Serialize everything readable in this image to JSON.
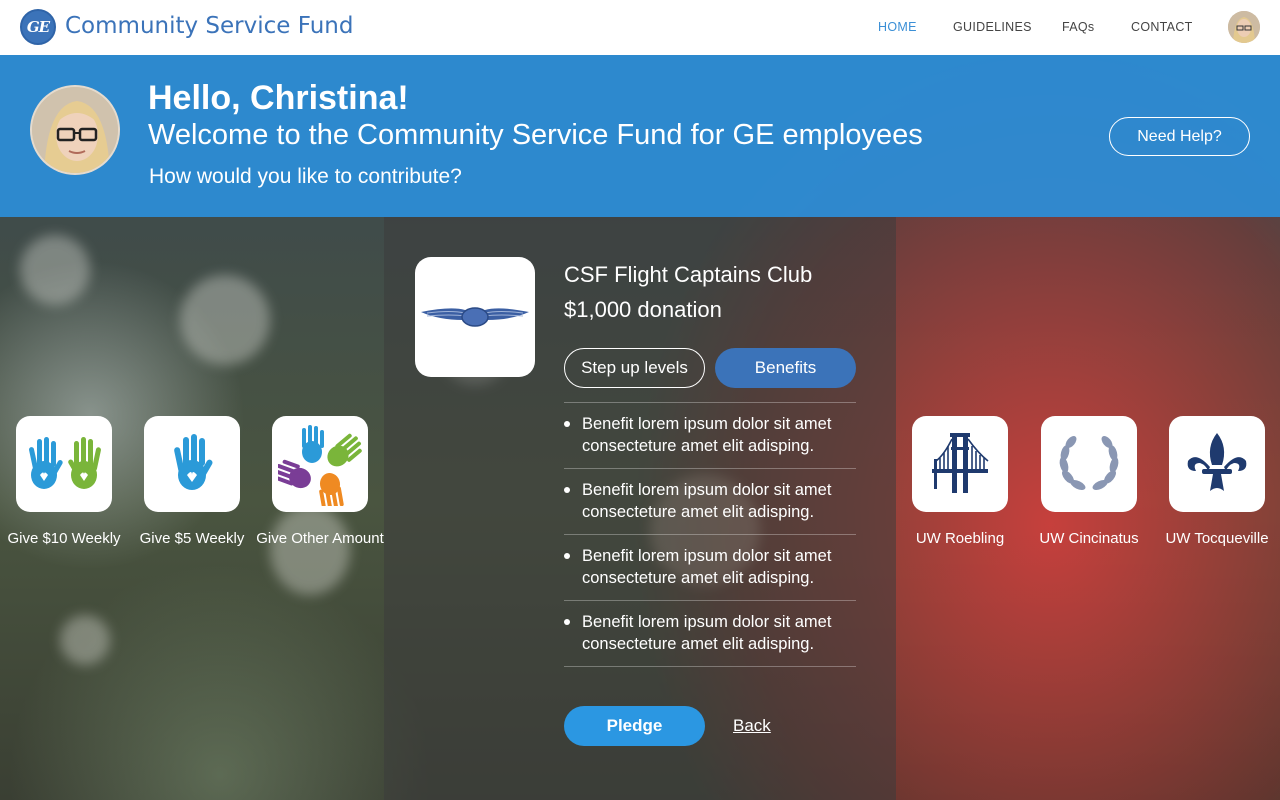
{
  "header": {
    "logo_text": "GE",
    "brand": "Community Service Fund",
    "nav": [
      "HOME",
      "GUIDELINES",
      "FAQs",
      "CONTACT"
    ],
    "active_nav": "HOME"
  },
  "banner": {
    "hello": "Hello, Christina!",
    "welcome": "Welcome to the Community Service Fund for GE employees",
    "question": "How would you like to contribute?",
    "help_button": "Need Help?"
  },
  "left_options": [
    {
      "label": "Give $10 Weekly",
      "icon": "two-hands-icon"
    },
    {
      "label": "Give $5 Weekly",
      "icon": "hand-icon"
    },
    {
      "label": "Give Other Amount",
      "icon": "many-hands-icon"
    }
  ],
  "club": {
    "title": "CSF Flight Captains Club",
    "amount": "$1,000 donation",
    "icon": "wings-icon",
    "tabs": [
      "Step up levels",
      "Benefits"
    ],
    "active_tab": "Benefits",
    "benefits": [
      "Benefit lorem ipsum dolor sit amet consecteture amet elit adisping.",
      "Benefit lorem ipsum dolor sit amet consecteture amet elit adisping.",
      "Benefit lorem ipsum dolor sit amet consecteture amet elit adisping.",
      "Benefit lorem ipsum dolor sit amet consecteture amet elit adisping."
    ],
    "pledge_button": "Pledge",
    "back_link": "Back"
  },
  "right_options": [
    {
      "label": "UW Roebling",
      "icon": "bridge-icon"
    },
    {
      "label": "UW Cincinatus",
      "icon": "laurel-wreath-icon"
    },
    {
      "label": "UW Tocqueville",
      "icon": "fleur-de-lis-icon"
    }
  ],
  "colors": {
    "brand_blue": "#3b73b9",
    "banner_blue": "#2c8ed8",
    "pledge_blue": "#2b97e2",
    "nav_active": "#3b8fd6"
  }
}
